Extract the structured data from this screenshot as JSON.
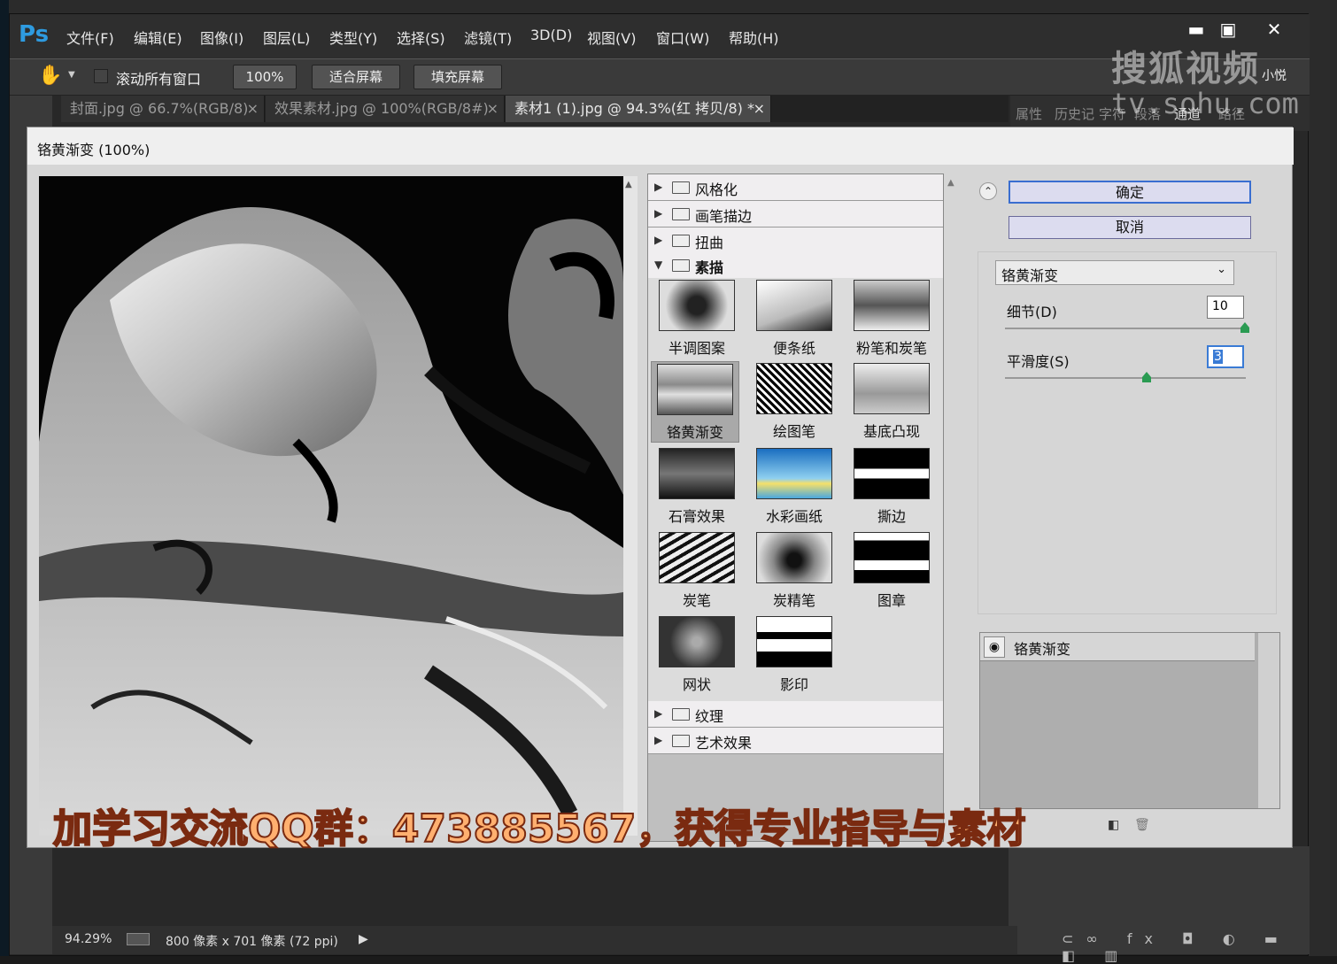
{
  "app": {
    "logo": "Ps"
  },
  "menu": [
    "文件(F)",
    "编辑(E)",
    "图像(I)",
    "图层(L)",
    "类型(Y)",
    "选择(S)",
    "滤镜(T)",
    "3D(D)",
    "视图(V)",
    "窗口(W)",
    "帮助(H)"
  ],
  "window_buttons": {
    "minimize": "▬",
    "maximize": "▣",
    "close": "✕"
  },
  "options": {
    "scroll_all_label": "滚动所有窗口",
    "zoom_btn": "100%",
    "fit_btn": "适合屏幕",
    "fill_btn": "填充屏幕"
  },
  "tabs": [
    {
      "label": "封面.jpg @ 66.7%(RGB/8)",
      "close": "×"
    },
    {
      "label": "效果素材.jpg @ 100%(RGB/8#)",
      "close": "×"
    },
    {
      "label": "素材1 (1).jpg @ 94.3%(红 拷贝/8) *",
      "close": "×"
    }
  ],
  "panel_tabs": [
    "属性",
    "历史记",
    "字符",
    "段落",
    "通道",
    "路径"
  ],
  "watermark": {
    "line1": "搜狐视频",
    "line2": "tv.sohu.com",
    "tag": "小悦"
  },
  "dialog": {
    "title": "铬黄渐变 (100%)",
    "categories_top": [
      "风格化",
      "画笔描边",
      "扭曲"
    ],
    "category_open": "素描",
    "categories_bottom": [
      "纹理",
      "艺术效果"
    ],
    "thumbnails": [
      "半调图案",
      "便条纸",
      "粉笔和炭笔",
      "铬黄渐变",
      "绘图笔",
      "基底凸现",
      "石膏效果",
      "水彩画纸",
      "撕边",
      "炭笔",
      "炭精笔",
      "图章",
      "网状",
      "影印"
    ],
    "selected_thumbnail": "铬黄渐变",
    "ok": "确定",
    "cancel": "取消",
    "filter_select": "铬黄渐变",
    "detail_label": "细节(D)",
    "detail_value": "10",
    "smooth_label": "平滑度(S)",
    "smooth_value": "3",
    "layer_name": "铬黄渐变"
  },
  "status": {
    "zoom": "94.29%",
    "info": "800 像素 x 701 像素 (72 ppi)"
  },
  "banner": "加学习交流QQ群：473885567，获得专业指导与素材"
}
